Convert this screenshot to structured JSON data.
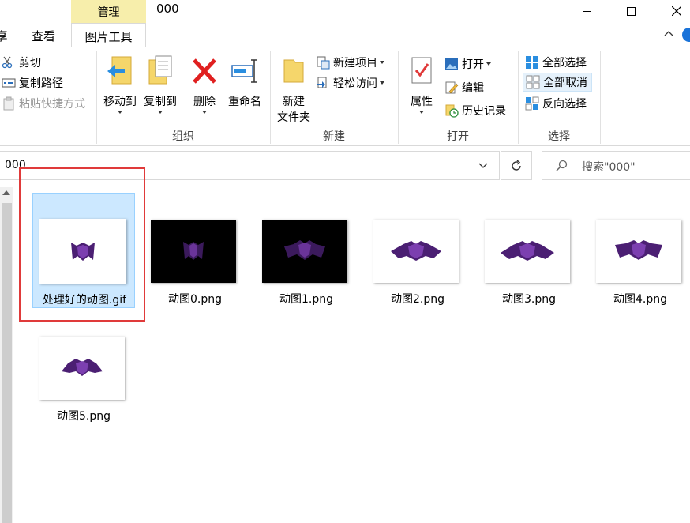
{
  "window": {
    "title": "000",
    "context_group_label": "管理",
    "context_group_color": "#f7eeab"
  },
  "tabs": [
    {
      "label": "享"
    },
    {
      "label": "查看"
    },
    {
      "label": "图片工具",
      "active": true
    }
  ],
  "ribbon": {
    "clipboard": {
      "cut": "剪切",
      "copy_path": "复制路径",
      "paste_shortcut": "粘贴快捷方式"
    },
    "organize": {
      "label": "组织",
      "move_to": "移动到",
      "copy_to": "复制到",
      "delete": "删除",
      "rename": "重命名"
    },
    "new": {
      "label": "新建",
      "new_folder_line1": "新建",
      "new_folder_line2": "文件夹",
      "new_item": "新建项目",
      "easy_access": "轻松访问"
    },
    "open": {
      "label": "打开",
      "properties": "属性",
      "open": "打开",
      "edit": "编辑",
      "history": "历史记录"
    },
    "select": {
      "label": "选择",
      "select_all": "全部选择",
      "select_none": "全部取消",
      "invert_selection": "反向选择"
    }
  },
  "address_bar": {
    "path": "000",
    "search_placeholder": "搜索\"000\""
  },
  "files": [
    {
      "name": "处理好的动图.gif",
      "selected": true,
      "bg": "#ffffff"
    },
    {
      "name": "动图0.png",
      "bg": "#000000"
    },
    {
      "name": "动图1.png",
      "bg": "#000000"
    },
    {
      "name": "动图2.png",
      "bg": "#ffffff"
    },
    {
      "name": "动图3.png",
      "bg": "#ffffff"
    },
    {
      "name": "动图4.png",
      "bg": "#ffffff"
    },
    {
      "name": "动图5.png",
      "bg": "#ffffff"
    }
  ],
  "colors": {
    "accent": "#1a73d9",
    "selection_bg": "#cce8ff",
    "highlight": "#e03a3a",
    "bat_purple": "#4b1f73"
  }
}
